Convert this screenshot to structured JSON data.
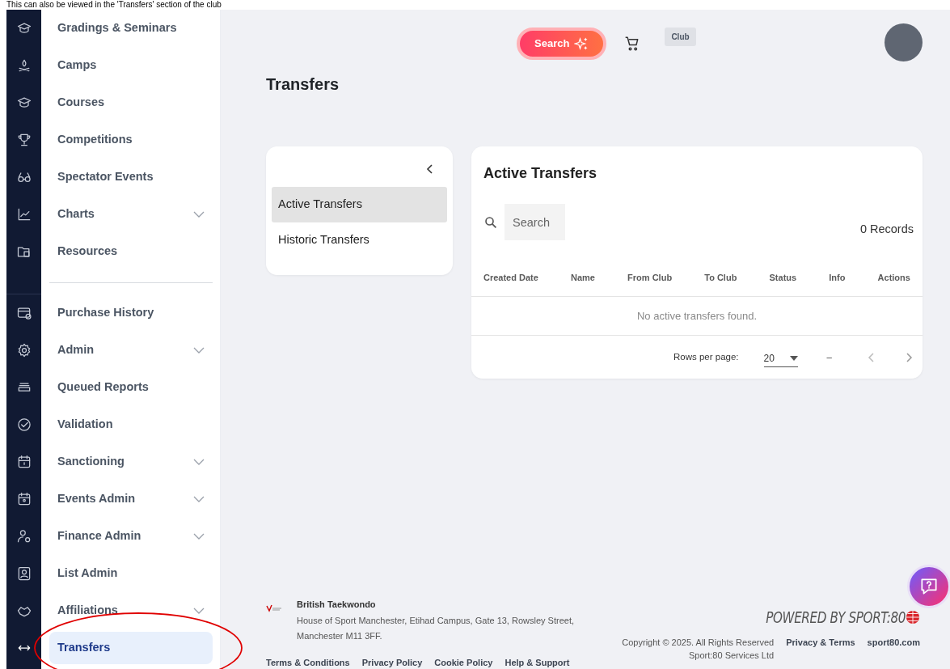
{
  "caption": "This can also be viewed in the 'Transfers' section of the club",
  "sidebar": {
    "groups": [
      {
        "items": [
          {
            "label": "Gradings & Seminars",
            "expandable": false,
            "selected": false,
            "circled": false
          },
          {
            "label": "Camps",
            "expandable": false,
            "selected": false,
            "circled": false
          },
          {
            "label": "Courses",
            "expandable": false,
            "selected": false,
            "circled": false
          },
          {
            "label": "Competitions",
            "expandable": false,
            "selected": false,
            "circled": false
          },
          {
            "label": "Spectator Events",
            "expandable": false,
            "selected": false,
            "circled": false
          },
          {
            "label": "Charts",
            "expandable": true,
            "selected": false,
            "circled": false
          },
          {
            "label": "Resources",
            "expandable": false,
            "selected": false,
            "circled": false
          }
        ]
      },
      {
        "items": [
          {
            "label": "Purchase History",
            "expandable": false,
            "selected": false,
            "circled": false
          },
          {
            "label": "Admin",
            "expandable": true,
            "selected": false,
            "circled": false
          },
          {
            "label": "Queued Reports",
            "expandable": false,
            "selected": false,
            "circled": false
          },
          {
            "label": "Validation",
            "expandable": false,
            "selected": false,
            "circled": false
          },
          {
            "label": "Sanctioning",
            "expandable": true,
            "selected": false,
            "circled": false
          },
          {
            "label": "Events Admin",
            "expandable": true,
            "selected": false,
            "circled": false
          },
          {
            "label": "Finance Admin",
            "expandable": true,
            "selected": false,
            "circled": false
          },
          {
            "label": "List Admin",
            "expandable": false,
            "selected": false,
            "circled": false
          },
          {
            "label": "Affiliations",
            "expandable": true,
            "selected": false,
            "circled": false
          },
          {
            "label": "Transfers",
            "expandable": false,
            "selected": true,
            "circled": true
          }
        ]
      }
    ]
  },
  "topbar": {
    "search_button": "Search",
    "badge": "Club"
  },
  "page_title": "Transfers",
  "subnav": {
    "items": [
      {
        "label": "Active Transfers",
        "selected": true
      },
      {
        "label": "Historic Transfers",
        "selected": false
      }
    ]
  },
  "panel": {
    "title": "Active Transfers",
    "search": {
      "placeholder": "Search"
    },
    "records": "0 Records",
    "columns": [
      "Created Date",
      "Name",
      "From Club",
      "To Club",
      "Status",
      "Info",
      "Actions"
    ],
    "empty_message": "No active transfers found.",
    "pagination": {
      "rows_label": "Rows per page:",
      "rows_value": "20",
      "range": "–"
    }
  },
  "footer": {
    "org_name": "British Taekwondo",
    "address": [
      "House of Sport Manchester, Etihad Campus, Gate 13, Rowsley Street,",
      "Manchester M11 3FF."
    ],
    "links": [
      "Terms & Conditions",
      "Privacy Policy",
      "Cookie Policy",
      "Help & Support"
    ],
    "powered_by": "POWERED BY SPORT:80",
    "copyright": "Copyright © 2025. All Rights Reserved",
    "company": "Sport:80 Services Ltd",
    "right_links": [
      "Privacy & Terms",
      "sport80.com"
    ]
  }
}
